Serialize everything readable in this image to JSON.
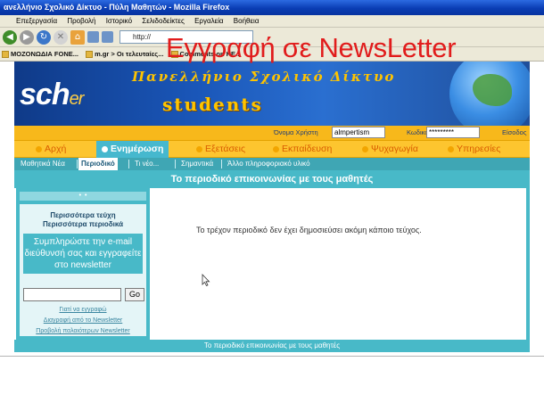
{
  "slide": {
    "title": "Εγγραφή σε NewsLetter"
  },
  "browser": {
    "window_title": "ανελλήνιο Σχολικό Δίκτυο - Πύλη Μαθητών - Mozilla Firefox",
    "menu": [
      "Επεξεργασία",
      "Προβολή",
      "Ιστορικό",
      "Σελιδοδείκτες",
      "Εργαλεία",
      "Βοήθεια"
    ],
    "address": "http://",
    "bookmarks": [
      "ΜΟΖΟΝΩΔΙΑ FONE...",
      "m.gr > Οι τελευταίες...",
      "Comments on KE..."
    ]
  },
  "site": {
    "logo": {
      "main": "sch",
      "suffix": "er"
    },
    "banner_title": "Πανελλήνιο Σχολικό Δίκτυο",
    "banner_subtitle": "students",
    "login": {
      "username_label": "Όνομα Χρήστη",
      "username_value": "almpertism",
      "password_label": "Κωδικός",
      "password_value": "*********",
      "submit_label": "Είσοδος"
    },
    "main_nav": [
      {
        "label": "Αρχή",
        "active": false
      },
      {
        "label": "Ενημέρωση",
        "active": true
      },
      {
        "label": "Εξετάσεις",
        "active": false
      },
      {
        "label": "Εκπαίδευση",
        "active": false
      },
      {
        "label": "Ψυχαγωγία",
        "active": false
      },
      {
        "label": "Υπηρεσίες",
        "active": false
      }
    ],
    "sub_nav": [
      {
        "label": "Μαθητικά Νέα",
        "active": false
      },
      {
        "label": "Περιοδικό",
        "active": true
      },
      {
        "label": "Τι νέο...",
        "active": false
      },
      {
        "label": "Σημαντικά",
        "active": false
      },
      {
        "label": "Άλλο πληροφοριακό υλικό",
        "active": false
      }
    ],
    "section_title": "Το περιοδικό επικοινωνίας με τους μαθητές",
    "sidebar": {
      "dots": "• •",
      "link_more_issues": "Περισσότερα τεύχη",
      "link_more_magazines": "Περισσότερα περιοδικά",
      "newsletter_prompt": "Συμπληρώστε την e-mail διεύθυνσή σας και εγγραφείτε στο newsletter",
      "email_value": "",
      "go_label": "Go",
      "link_help": "Γιατί να εγγραφώ",
      "link_unsubscribe": "Διαγραφή από το Newsletter",
      "link_previous": "Προβολή παλαιότερων Newsletter"
    },
    "content_message": "Το τρέχον περιοδικό δεν έχει δημοσιεύσει ακόμη κάποιο τεύχος.",
    "footer_text": "Το περιοδικό επικοινωνίας με τους μαθητές"
  }
}
